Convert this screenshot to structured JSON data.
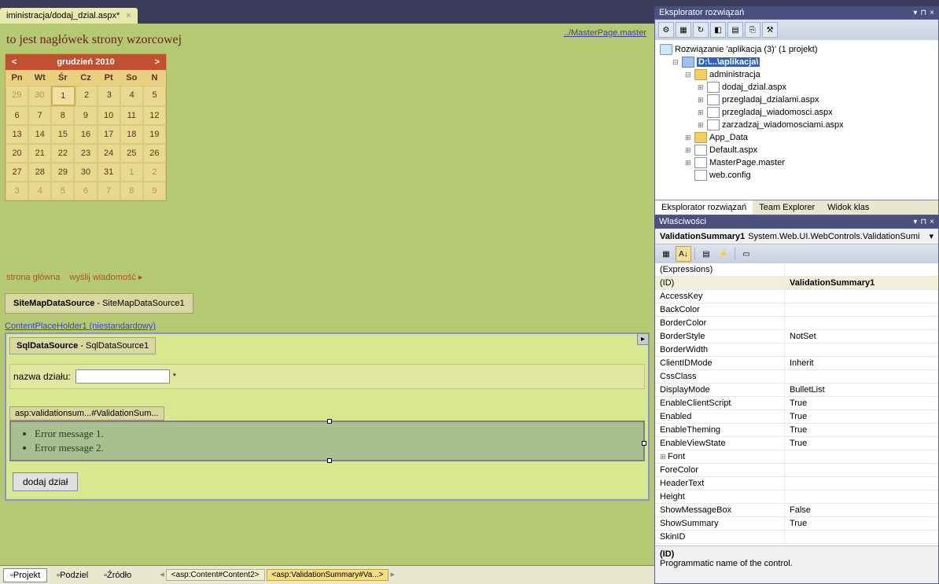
{
  "tab": {
    "title": "iministracja/dodaj_dzial.aspx*",
    "close": "×"
  },
  "masterLink": "../MasterPage.master",
  "heading": "to jest nagłówek strony wzorcowej",
  "calendar": {
    "title": "grudzień 2010",
    "prev": "<",
    "next": ">",
    "dayHeads": [
      "Pn",
      "Wt",
      "Śr",
      "Cz",
      "Pt",
      "So",
      "N"
    ],
    "weeks": [
      [
        {
          "d": "29",
          "o": true
        },
        {
          "d": "30",
          "o": true
        },
        {
          "d": "1",
          "sel": true
        },
        {
          "d": "2"
        },
        {
          "d": "3"
        },
        {
          "d": "4"
        },
        {
          "d": "5"
        }
      ],
      [
        {
          "d": "6"
        },
        {
          "d": "7"
        },
        {
          "d": "8"
        },
        {
          "d": "9"
        },
        {
          "d": "10"
        },
        {
          "d": "11"
        },
        {
          "d": "12"
        }
      ],
      [
        {
          "d": "13"
        },
        {
          "d": "14"
        },
        {
          "d": "15"
        },
        {
          "d": "16"
        },
        {
          "d": "17"
        },
        {
          "d": "18"
        },
        {
          "d": "19"
        }
      ],
      [
        {
          "d": "20"
        },
        {
          "d": "21"
        },
        {
          "d": "22"
        },
        {
          "d": "23"
        },
        {
          "d": "24"
        },
        {
          "d": "25"
        },
        {
          "d": "26"
        }
      ],
      [
        {
          "d": "27"
        },
        {
          "d": "28"
        },
        {
          "d": "29"
        },
        {
          "d": "30"
        },
        {
          "d": "31"
        },
        {
          "d": "1",
          "o": true
        },
        {
          "d": "2",
          "o": true
        }
      ],
      [
        {
          "d": "3",
          "o": true
        },
        {
          "d": "4",
          "o": true
        },
        {
          "d": "5",
          "o": true
        },
        {
          "d": "6",
          "o": true
        },
        {
          "d": "7",
          "o": true
        },
        {
          "d": "8",
          "o": true
        },
        {
          "d": "9",
          "o": true
        }
      ]
    ]
  },
  "links": {
    "home": "strona główna",
    "send": "wyślij wiadomość ▸"
  },
  "sitemapDs": {
    "type": "SiteMapDataSource",
    "name": " - SiteMapDataSource1"
  },
  "cphLabel": "ContentPlaceHolder1 (niestandardowy)",
  "sqlDs": {
    "type": "SqlDataSource",
    "name": " - SqlDataSource1"
  },
  "field": {
    "label": "nazwa działu:",
    "req": "*"
  },
  "vsTag": "asp:validationsum...#ValidationSum...",
  "errors": [
    "Error message 1.",
    "Error message 2."
  ],
  "addBtn": "dodaj dział",
  "bottomTabs": {
    "design": "Projekt",
    "split": "Podziel",
    "source": "Źródło"
  },
  "breadcrumb": [
    "<asp:Content#Content2>",
    "<asp:ValidationSummary#Va...>"
  ],
  "sqlTag": "▸",
  "solutionHeader": "Eksplorator rozwiązań",
  "solutionTree": {
    "root": "Rozwiązanie 'aplikacja (3)' (1 projekt)",
    "proj": "D:\\...\\aplikacja\\",
    "folder1": "administracja",
    "files1": [
      "dodaj_dzial.aspx",
      "przegladaj_dzialami.aspx",
      "przegladaj_wiadomosci.aspx",
      "zarzadzaj_wiadomosciami.aspx"
    ],
    "appdata": "App_Data",
    "files2": [
      "Default.aspx",
      "MasterPage.master",
      "web.config"
    ]
  },
  "solTabs": [
    "Eksplorator rozwiązań",
    "Team Explorer",
    "Widok klas"
  ],
  "propsHeader": "Właściwości",
  "propsObj": {
    "name": "ValidationSummary1",
    "type": "System.Web.UI.WebControls.ValidationSumi"
  },
  "props": [
    {
      "n": "(Expressions)",
      "v": ""
    },
    {
      "n": "(ID)",
      "v": "ValidationSummary1",
      "sel": true,
      "bold": true
    },
    {
      "n": "AccessKey",
      "v": ""
    },
    {
      "n": "BackColor",
      "v": ""
    },
    {
      "n": "BorderColor",
      "v": ""
    },
    {
      "n": "BorderStyle",
      "v": "NotSet"
    },
    {
      "n": "BorderWidth",
      "v": ""
    },
    {
      "n": "ClientIDMode",
      "v": "Inherit"
    },
    {
      "n": "CssClass",
      "v": ""
    },
    {
      "n": "DisplayMode",
      "v": "BulletList"
    },
    {
      "n": "EnableClientScript",
      "v": "True"
    },
    {
      "n": "Enabled",
      "v": "True"
    },
    {
      "n": "EnableTheming",
      "v": "True"
    },
    {
      "n": "EnableViewState",
      "v": "True"
    },
    {
      "n": "Font",
      "v": "",
      "exp": true
    },
    {
      "n": "ForeColor",
      "v": ""
    },
    {
      "n": "HeaderText",
      "v": ""
    },
    {
      "n": "Height",
      "v": ""
    },
    {
      "n": "ShowMessageBox",
      "v": "False"
    },
    {
      "n": "ShowSummary",
      "v": "True"
    },
    {
      "n": "SkinID",
      "v": ""
    }
  ],
  "propsDesc": {
    "title": "(ID)",
    "text": "Programmatic name of the control."
  }
}
